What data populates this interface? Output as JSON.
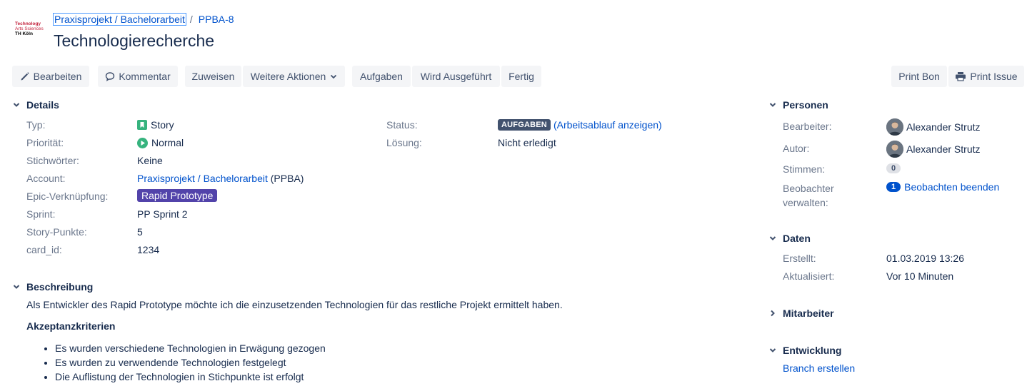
{
  "logo": {
    "line1": "Technology",
    "line2": "Arts Sciences",
    "line3": "TH Köln"
  },
  "breadcrumb": {
    "project": "Praxisprojekt / Bachelorarbeit",
    "separator": "/",
    "issue_key": "PPBA-8"
  },
  "issue_title": "Technologierecherche",
  "toolbar": {
    "edit": "Bearbeiten",
    "comment": "Kommentar",
    "assign": "Zuweisen",
    "more": "Weitere Aktionen",
    "todo": "Aufgaben",
    "in_progress": "Wird Ausgeführt",
    "done": "Fertig",
    "print_bon": "Print Bon",
    "print_issue": "Print Issue"
  },
  "details": {
    "heading": "Details",
    "type_label": "Typ:",
    "type_value": "Story",
    "priority_label": "Priorität:",
    "priority_value": "Normal",
    "labels_label": "Stichwörter:",
    "labels_value": "Keine",
    "account_label": "Account:",
    "account_link": "Praxisprojekt / Bachelorarbeit",
    "account_suffix": "(PPBA)",
    "epic_label": "Epic-Verknüpfung:",
    "epic_value": "Rapid Prototype",
    "sprint_label": "Sprint:",
    "sprint_value": "PP Sprint 2",
    "points_label": "Story-Punkte:",
    "points_value": "5",
    "cardid_label": "card_id:",
    "cardid_value": "1234",
    "status_label": "Status:",
    "status_value": "AUFGABEN",
    "status_paren_open": "(",
    "workflow_link": "Arbeitsablauf anzeigen",
    "status_paren_close": ")",
    "resolution_label": "Lösung:",
    "resolution_value": "Nicht erledigt"
  },
  "description": {
    "heading": "Beschreibung",
    "text": "Als Entwickler des Rapid Prototype möchte ich die einzusetzenden Technologien für das restliche Projekt ermittelt haben.",
    "criteria_heading": "Akzeptanzkriterien",
    "criteria": [
      "Es wurden verschiedene Technologien in Erwägung gezogen",
      "Es wurden zu verwendende Technologien festgelegt",
      "Die Auflistung der Technologien in Stichpunkte ist erfolgt"
    ]
  },
  "people": {
    "heading": "Personen",
    "assignee_label": "Bearbeiter:",
    "assignee": "Alexander Strutz",
    "reporter_label": "Autor:",
    "reporter": "Alexander Strutz",
    "votes_label": "Stimmen:",
    "votes": "0",
    "watchers_label_1": "Beobachter",
    "watchers_label_2": "verwalten:",
    "watchers_count": "1",
    "watch_link": "Beobachten beenden"
  },
  "dates": {
    "heading": "Daten",
    "created_label": "Erstellt:",
    "created": "01.03.2019 13:26",
    "updated_label": "Aktualisiert:",
    "updated": "Vor 10 Minuten"
  },
  "collaborators": {
    "heading": "Mitarbeiter"
  },
  "development": {
    "heading": "Entwicklung",
    "branch_link": "Branch erstellen"
  },
  "colors": {
    "link": "#0052cc",
    "text": "#172b4d",
    "label": "#6b778c",
    "button_bg": "#f4f5f7",
    "status_lozenge": "#42526e",
    "epic": "#5243aa",
    "story_icon": "#36b37e",
    "priority_icon": "#36b37e"
  },
  "icons": {
    "edit": "pencil-icon",
    "comment": "speech-bubble-icon",
    "more": "chevron-down-icon",
    "print": "printer-icon",
    "section_open": "chevron-down-icon",
    "section_closed": "chevron-right-icon",
    "type": "story-bookmark-icon",
    "priority": "priority-play-icon"
  }
}
